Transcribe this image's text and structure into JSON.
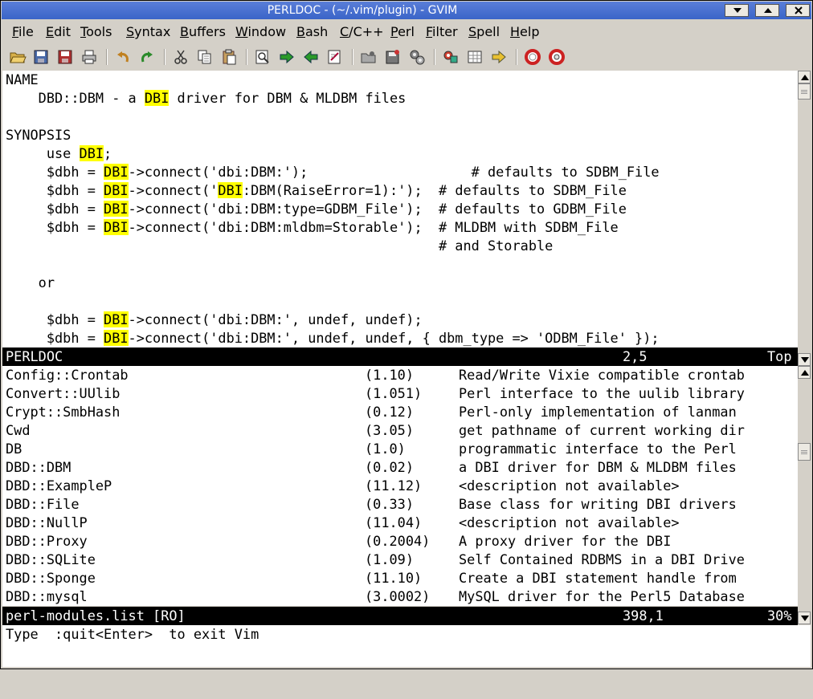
{
  "window": {
    "title": "PERLDOC - (~/.vim/plugin) - GVIM"
  },
  "menu": [
    {
      "label": "File",
      "mnemonic_index": 0
    },
    {
      "label": "Edit",
      "mnemonic_index": 0
    },
    {
      "label": "Tools",
      "mnemonic_index": 0
    },
    {
      "label": "Syntax",
      "mnemonic_index": 0
    },
    {
      "label": "Buffers",
      "mnemonic_index": 0
    },
    {
      "label": "Window",
      "mnemonic_index": 0
    },
    {
      "label": "Bash",
      "mnemonic_index": 0
    },
    {
      "label": "C/C++",
      "mnemonic_index": 0
    },
    {
      "label": "Perl",
      "mnemonic_index": 0
    },
    {
      "label": "Filter",
      "mnemonic_index": 0
    },
    {
      "label": "Spell",
      "mnemonic_index": 0
    },
    {
      "label": "Help",
      "mnemonic_index": 0
    }
  ],
  "toolbar_icons": [
    "open-icon",
    "save-icon",
    "save-all-icon",
    "print-icon",
    "undo-icon",
    "redo-icon",
    "cut-icon",
    "copy-icon",
    "paste-icon",
    "find-icon",
    "find-next-icon",
    "find-prev-icon",
    "replace-icon",
    "session-open-icon",
    "session-save-icon",
    "run-script-icon",
    "make-icon",
    "shell-icon",
    "tags-icon",
    "help-icon",
    "find-help-icon"
  ],
  "colors": {
    "highlight": "#ffff00",
    "statusline_bg": "#000000",
    "titlebar": "#3a64c8"
  },
  "top_pane": {
    "lines": [
      [
        {
          "t": "NAME"
        }
      ],
      [
        {
          "t": "    DBD::DBM - a "
        },
        {
          "t": "DBI",
          "hl": true
        },
        {
          "t": " driver for DBM & MLDBM files"
        }
      ],
      [
        {
          "t": ""
        }
      ],
      [
        {
          "t": "SYNOPSIS"
        }
      ],
      [
        {
          "t": "     use "
        },
        {
          "t": "DBI",
          "hl": true
        },
        {
          "t": ";"
        }
      ],
      [
        {
          "t": "     $dbh = "
        },
        {
          "t": "DBI",
          "hl": true
        },
        {
          "t": "->connect('dbi:DBM:');                    # defaults to SDBM_File"
        }
      ],
      [
        {
          "t": "     $dbh = "
        },
        {
          "t": "DBI",
          "hl": true
        },
        {
          "t": "->connect('"
        },
        {
          "t": "DBI",
          "hl": true
        },
        {
          "t": ":DBM(RaiseError=1):');  # defaults to SDBM_File"
        }
      ],
      [
        {
          "t": "     $dbh = "
        },
        {
          "t": "DBI",
          "hl": true
        },
        {
          "t": "->connect('dbi:DBM:type=GDBM_File');  # defaults to GDBM_File"
        }
      ],
      [
        {
          "t": "     $dbh = "
        },
        {
          "t": "DBI",
          "hl": true
        },
        {
          "t": "->connect('dbi:DBM:mldbm=Storable');  # MLDBM with SDBM_File"
        }
      ],
      [
        {
          "t": "                                                     # and Storable"
        }
      ],
      [
        {
          "t": ""
        }
      ],
      [
        {
          "t": "    or"
        }
      ],
      [
        {
          "t": ""
        }
      ],
      [
        {
          "t": "     $dbh = "
        },
        {
          "t": "DBI",
          "hl": true
        },
        {
          "t": "->connect('dbi:DBM:', undef, undef);"
        }
      ],
      [
        {
          "t": "     $dbh = "
        },
        {
          "t": "DBI",
          "hl": true
        },
        {
          "t": "->connect('dbi:DBM:', undef, undef, { dbm_type => 'ODBM_File' });"
        }
      ]
    ]
  },
  "top_status": {
    "name": "PERLDOC",
    "position": "2,5",
    "percent": "Top"
  },
  "module_list": {
    "rows": [
      {
        "name": "Config::Crontab",
        "version": "(1.10)",
        "description": "Read/Write Vixie compatible crontab"
      },
      {
        "name": "Convert::UUlib",
        "version": "(1.051)",
        "description": "Perl interface to the uulib library"
      },
      {
        "name": "Crypt::SmbHash",
        "version": "(0.12)",
        "description": "Perl-only implementation of lanman"
      },
      {
        "name": "Cwd",
        "version": "(3.05)",
        "description": "get pathname of current working dir"
      },
      {
        "name": "DB",
        "version": "(1.0)",
        "description": "programmatic interface to the Perl"
      },
      {
        "name": "DBD::DBM",
        "version": "(0.02)",
        "description": "a DBI driver for DBM & MLDBM files"
      },
      {
        "name": "DBD::ExampleP",
        "version": "(11.12)",
        "description": "<description not available>"
      },
      {
        "name": "DBD::File",
        "version": "(0.33)",
        "description": "Base class for writing DBI drivers"
      },
      {
        "name": "DBD::NullP",
        "version": "(11.04)",
        "description": "<description not available>"
      },
      {
        "name": "DBD::Proxy",
        "version": "(0.2004)",
        "description": "A proxy driver for the DBI"
      },
      {
        "name": "DBD::SQLite",
        "version": "(1.09)",
        "description": "Self Contained RDBMS in a DBI Drive"
      },
      {
        "name": "DBD::Sponge",
        "version": "(11.10)",
        "description": "Create a DBI statement handle from"
      },
      {
        "name": "DBD::mysql",
        "version": "(3.0002)",
        "description": "MySQL driver for the Perl5 Database"
      }
    ]
  },
  "bottom_status": {
    "name": "perl-modules.list [RO]",
    "position": "398,1",
    "percent": "30%"
  },
  "command_line": {
    "text": "Type  :quit<Enter>  to exit Vim"
  },
  "scroll": {
    "top_pane_fraction": 0.0,
    "bottom_pane_fraction": 0.3
  }
}
